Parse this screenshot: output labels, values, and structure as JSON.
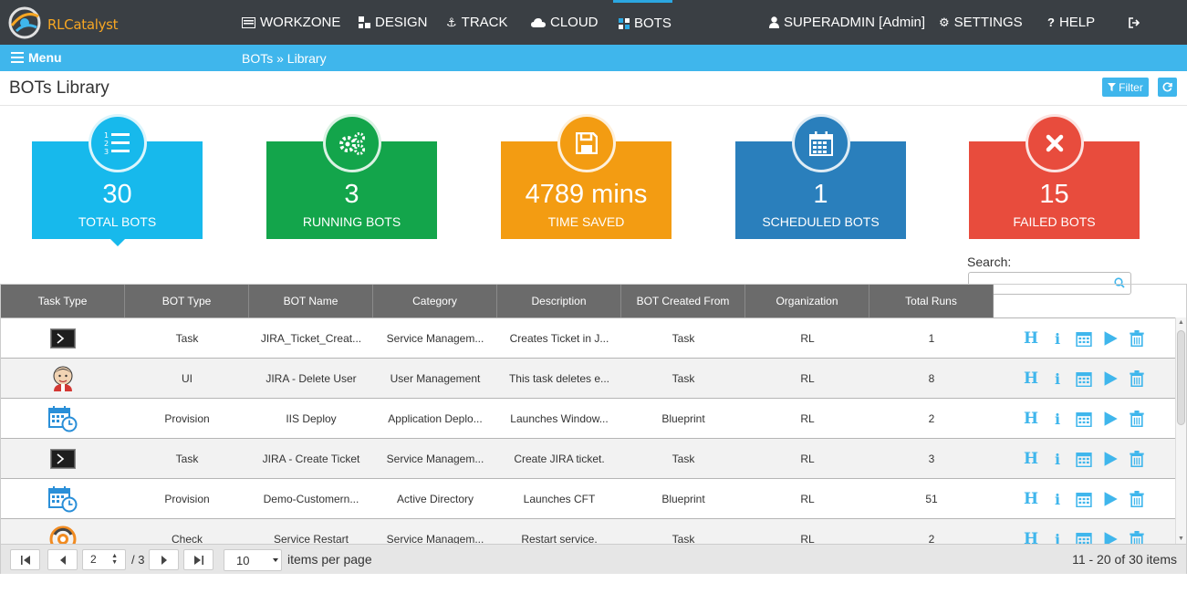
{
  "app": {
    "logo_text": "RLCatalyst",
    "nav": [
      {
        "label": "WORKZONE",
        "icon": "monitor-icon"
      },
      {
        "label": "DESIGN",
        "icon": "sitemap-icon"
      },
      {
        "label": "TRACK",
        "icon": "anchor-icon"
      },
      {
        "label": "CLOUD",
        "icon": "cloud-icon"
      },
      {
        "label": "BOTS",
        "icon": "bots-icon",
        "active": true
      }
    ],
    "user": "SUPERADMIN [Admin]",
    "settings": "SETTINGS",
    "help": "HELP",
    "colors": {
      "topbar": "#3a3f44",
      "accent": "#3fb6ec"
    }
  },
  "subbar": {
    "menu_label": "Menu",
    "breadcrumb": "BOTs » Library"
  },
  "page": {
    "title": "BOTs Library",
    "filter_label": "Filter"
  },
  "stats": [
    {
      "value": "30",
      "label": "TOTAL BOTS",
      "color": "#17b9ec",
      "icon": "list-ol-icon"
    },
    {
      "value": "3",
      "label": "RUNNING BOTS",
      "color": "#13a54b",
      "icon": "cogs-icon"
    },
    {
      "value": "4789 mins",
      "label": "TIME SAVED",
      "color": "#f39c12",
      "icon": "save-icon"
    },
    {
      "value": "1",
      "label": "SCHEDULED BOTS",
      "color": "#2a7fbc",
      "icon": "calendar-icon"
    },
    {
      "value": "15",
      "label": "FAILED BOTS",
      "color": "#e84c3d",
      "icon": "times-icon"
    }
  ],
  "search": {
    "label": "Search:",
    "value": "",
    "placeholder": ""
  },
  "table": {
    "columns": [
      "Task Type",
      "BOT Type",
      "BOT Name",
      "Category",
      "Description",
      "BOT Created From",
      "Organization",
      "Total Runs"
    ],
    "rows": [
      {
        "task_type": "terminal-icon",
        "bot_type": "Task",
        "name": "JIRA_Ticket_Creat...",
        "category": "Service Managem...",
        "description": "Creates Ticket in J...",
        "created_from": "Task",
        "org": "RL",
        "runs": "1"
      },
      {
        "task_type": "jenkins-icon",
        "bot_type": "UI",
        "name": "JIRA - Delete User",
        "category": "User Management",
        "description": "This task deletes e...",
        "created_from": "Task",
        "org": "RL",
        "runs": "8"
      },
      {
        "task_type": "calendar-clock-icon",
        "bot_type": "Provision",
        "name": "IIS Deploy",
        "category": "Application Deplo...",
        "description": "Launches Window...",
        "created_from": "Blueprint",
        "org": "RL",
        "runs": "2"
      },
      {
        "task_type": "terminal-icon",
        "bot_type": "Task",
        "name": "JIRA - Create Ticket",
        "category": "Service Managem...",
        "description": "Create JIRA ticket.",
        "created_from": "Task",
        "org": "RL",
        "runs": "3"
      },
      {
        "task_type": "calendar-clock-icon",
        "bot_type": "Provision",
        "name": "Demo-Customern...",
        "category": "Active Directory",
        "description": "Launches CFT",
        "created_from": "Blueprint",
        "org": "RL",
        "runs": "51"
      },
      {
        "task_type": "chef-icon",
        "bot_type": "Check",
        "name": "Service Restart",
        "category": "Service Managem...",
        "description": "Restart service.",
        "created_from": "Task",
        "org": "RL",
        "runs": "2"
      }
    ],
    "row_actions": [
      "history-icon",
      "info-icon",
      "schedule-icon",
      "run-icon",
      "delete-icon"
    ]
  },
  "pager": {
    "page": "2",
    "total_pages": "/ 3",
    "page_size": "10",
    "items_per_page_label": "items per page",
    "info": "11 - 20 of 30 items"
  }
}
